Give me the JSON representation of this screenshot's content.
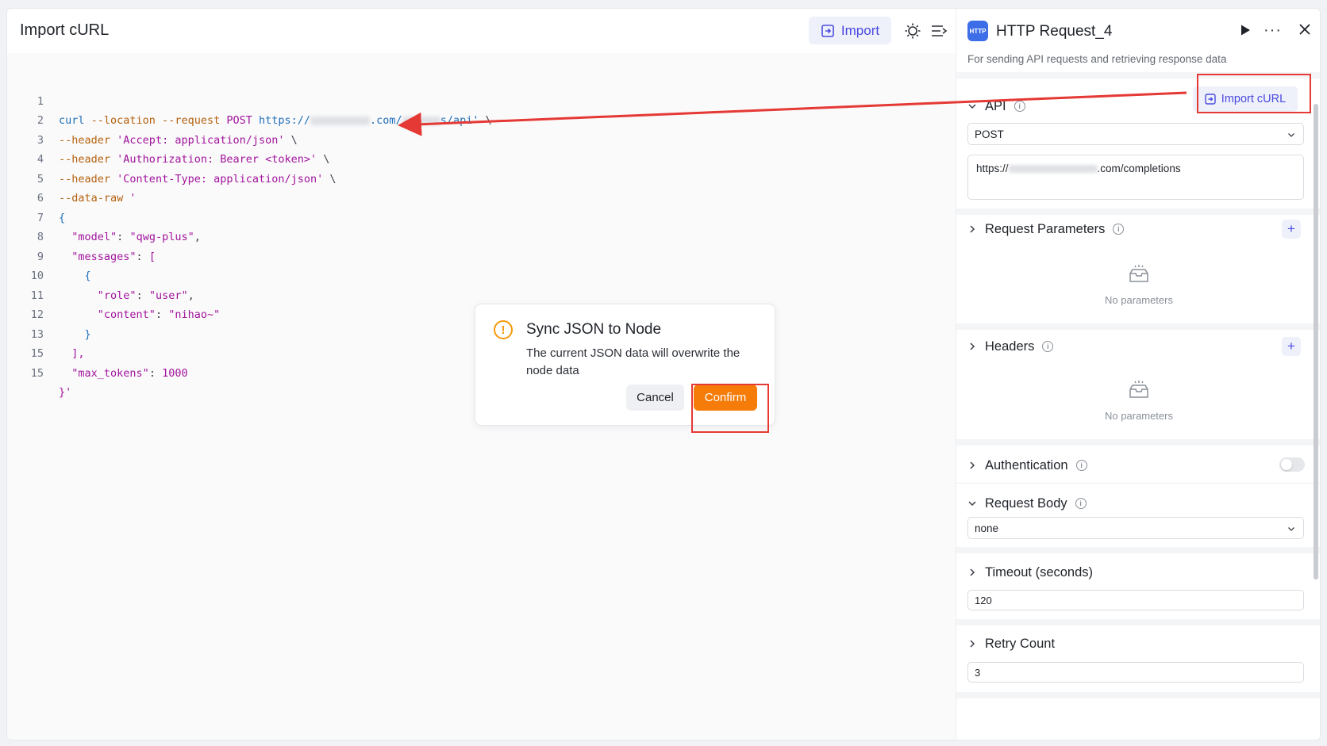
{
  "editor": {
    "title": "Import cURL",
    "import_label": "Import",
    "lines": [
      {
        "n": "1"
      },
      {
        "n": "2"
      },
      {
        "n": "3"
      },
      {
        "n": "4"
      },
      {
        "n": "5"
      },
      {
        "n": "6"
      },
      {
        "n": "7"
      },
      {
        "n": "8"
      },
      {
        "n": "9"
      },
      {
        "n": "10"
      },
      {
        "n": "11"
      },
      {
        "n": "12"
      },
      {
        "n": "13"
      },
      {
        "n": "15"
      }
    ],
    "code": {
      "l1_cmd": "curl",
      "l1_flag": "--location --request",
      "l1_method": "POST",
      "l1_url_a": "https://",
      "l1_url_b": ".com/",
      "l1_url_c": "s/api'",
      "l1_cont": "\\",
      "l2_flag": "--header",
      "l2_val": "'Accept: application/json'",
      "l3_flag": "--header",
      "l3_val": "'Authorization: Bearer <token>'",
      "l4_flag": "--header",
      "l4_val": "'Content-Type: application/json'",
      "cont": "\\",
      "l5_flag": "--data-raw",
      "l5_val": "'",
      "l6": "{",
      "l7_key": "\"model\"",
      "l7_val": "\"qwg-plus\"",
      "l8_key": "\"messages\"",
      "l8_val": "[",
      "l9": "{",
      "l10_key": "\"role\"",
      "l10_val": "\"user\"",
      "l11_key": "\"content\"",
      "l11_val": "\"nihao~\"",
      "l12": "}",
      "l13": "],",
      "l14_key": "\"max_tokens\"",
      "l14_val": "1000",
      "l15": "}'"
    }
  },
  "dialog": {
    "title": "Sync JSON to Node",
    "message": "The current JSON data will overwrite the node data",
    "cancel_label": "Cancel",
    "confirm_label": "Confirm"
  },
  "panel": {
    "icon_text": "HTTP",
    "title": "HTTP Request_4",
    "description": "For sending API requests and retrieving response data",
    "import_curl_label": "Import cURL",
    "api": {
      "label": "API",
      "method": "POST",
      "url_prefix": "https://",
      "url_suffix": ".com/completions"
    },
    "request_parameters": {
      "label": "Request Parameters",
      "empty_text": "No parameters"
    },
    "headers": {
      "label": "Headers",
      "empty_text": "No parameters"
    },
    "authentication": {
      "label": "Authentication",
      "enabled": false
    },
    "request_body": {
      "label": "Request Body",
      "value": "none"
    },
    "timeout": {
      "label": "Timeout (seconds)",
      "value": "120"
    },
    "retry": {
      "label": "Retry Count",
      "value": "3"
    }
  },
  "colors": {
    "accent": "#4a4ae0",
    "confirm": "#f57c08",
    "warning": "#f59a0b",
    "highlight": "#e53935"
  }
}
